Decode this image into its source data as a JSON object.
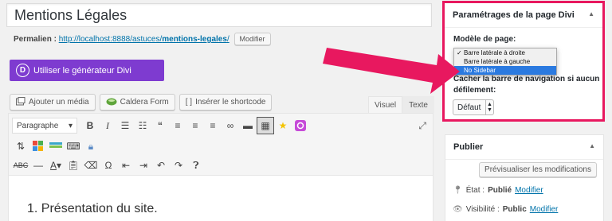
{
  "post": {
    "title": "Mentions Légales",
    "permalink_label": "Permalien :",
    "permalink_base": "http://localhost:8888/astuces/",
    "permalink_slug": "mentions-legales",
    "permalink_end": "/",
    "modify_label": "Modifier"
  },
  "divi_builder_button": "Utiliser le générateur Divi",
  "media_buttons": [
    {
      "label": "Ajouter un média",
      "icon": "media-icon"
    },
    {
      "label": "Caldera Form",
      "icon": "caldera-icon"
    },
    {
      "label": "Insérer le shortcode",
      "icon": "shortcode-icon"
    }
  ],
  "editor_tabs": {
    "visual": "Visuel",
    "text": "Texte"
  },
  "toolbar": {
    "format_select": "Paragraphe"
  },
  "content": "1. Présentation du site.",
  "divi_settings": {
    "title": "Paramétrages de la page Divi",
    "template_label": "Modèle de page:",
    "options": [
      "Barre latérale à droite",
      "Barre latérale à gauche",
      "No Sidebar"
    ],
    "selected_check": "✓",
    "hide_nav_label": "Cacher la barre de navigation si aucun défilement:",
    "hide_nav_value": "Défaut"
  },
  "publish": {
    "title": "Publier",
    "preview_button": "Prévisualiser les modifications",
    "status_label": "État :",
    "status_value": "Publié",
    "visibility_label": "Visibilité :",
    "visibility_value": "Public",
    "modify_link": "Modifier"
  },
  "colors": {
    "divi_purple": "#7e3bd0",
    "highlight_pink": "#e8185f",
    "link_blue": "#0073aa",
    "select_blue": "#2b7ae0"
  }
}
